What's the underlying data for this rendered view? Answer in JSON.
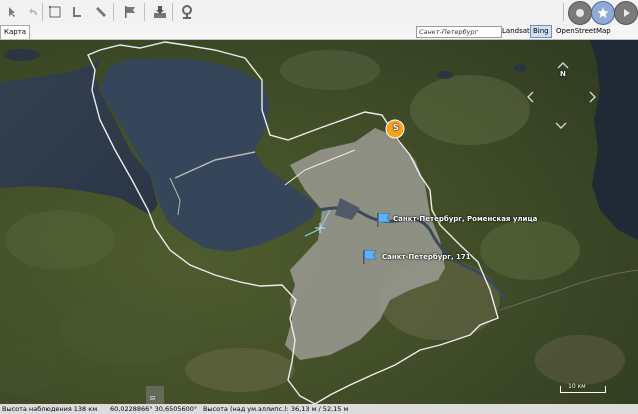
{
  "toolbar": {
    "icons": [
      "cursor-icon",
      "back-arrow-icon",
      "rectangle-select-icon",
      "ruler-icon",
      "line-icon",
      "flag-icon",
      "import-icon",
      "location-pin-icon"
    ],
    "right_icons": [
      "record-icon",
      "star-icon",
      "play-icon"
    ]
  },
  "tab": {
    "label": "Карта"
  },
  "search": {
    "value": "Санкт-Петербург"
  },
  "sources": {
    "landsat": "Landsat",
    "bing": "Bing",
    "osm": "OpenStreetMap",
    "active": "Bing"
  },
  "map": {
    "compass": "N",
    "places": [
      {
        "label": "Санкт-Петербург,  Роменская улица"
      },
      {
        "label": "Санкт-Петербург,  171"
      }
    ],
    "marker_letter": "S",
    "scale_label": "10 км"
  },
  "status": {
    "altitude": "Высота наблюдения 138 км",
    "coords": "60,0228866° 30,6505600°",
    "height": "Высота (над ум.эллипс.): 36,13 м / 52,15 м"
  }
}
